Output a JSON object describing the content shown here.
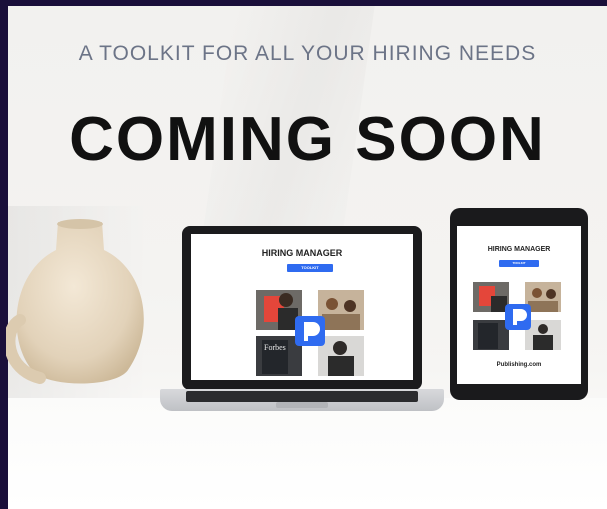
{
  "page": {
    "subtitle": "A TOOLKIT FOR ALL YOUR HIRING NEEDS",
    "headline": "COMING SOON"
  },
  "laptop_screen": {
    "title": "HIRING MANAGER",
    "button_label": "TOOLKIT"
  },
  "tablet_screen": {
    "title": "HIRING MANAGER",
    "button_label": "TOOLKIT",
    "footer": "Publishing.com"
  },
  "colors": {
    "brand_blue": "#2f6bf0",
    "headline": "#111111",
    "subtitle": "#6c7487",
    "border": "#1a0f3a"
  }
}
